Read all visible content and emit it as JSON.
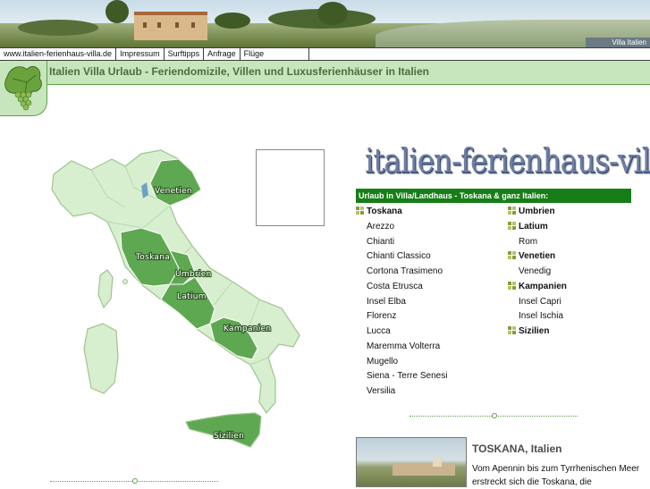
{
  "banner": {
    "caption": "Villa Italien"
  },
  "nav": {
    "items": [
      "www.italien-ferienhaus-villa.de",
      "Impressum",
      "Surftipps",
      "Anfrage",
      "Flüge"
    ]
  },
  "header": {
    "title": "Italien Villa Urlaub - Feriendomizile, Villen und Luxusferienhäuser in Italien"
  },
  "map": {
    "regions": [
      "Venetien",
      "Toskana",
      "Umbrien",
      "Latium",
      "Kampanien",
      "Sizilien"
    ],
    "colors": {
      "land": "#d8efcf",
      "highlight": "#5fa852",
      "border": "#9cc58f"
    }
  },
  "logo": {
    "text": "italien-ferienhaus-villa"
  },
  "section": {
    "heading": "Urlaub in Villa/Landhaus - Toskana & ganz Italien:"
  },
  "left_list": {
    "head": "Toskana",
    "items": [
      "Arezzo",
      "Chianti",
      "Chianti Classico",
      "Cortona Trasimeno",
      "Costa Etrusca",
      "Insel Elba",
      "Florenz",
      "Lucca",
      "Maremma Volterra",
      "Mugello",
      "Siena - Terre Senesi",
      "Versilia"
    ]
  },
  "right_list": {
    "umbrien": "Umbrien",
    "latium": "Latium",
    "rom": "Rom",
    "venetien": "Venetien",
    "venedig": "Venedig",
    "kampanien": "Kampanien",
    "capri": "Insel Capri",
    "ischia": "Insel Ischia",
    "sizilien": "Sizilien"
  },
  "teaser": {
    "title": "TOSKANA, Italien",
    "text": "Vom Apennin bis zum Tyrrhenischen Meer erstreckt sich die Toskana, die"
  },
  "colors": {
    "accent_green": "#177e17",
    "title_band": "#c7e6bd",
    "title_text": "#4c6e3d"
  }
}
